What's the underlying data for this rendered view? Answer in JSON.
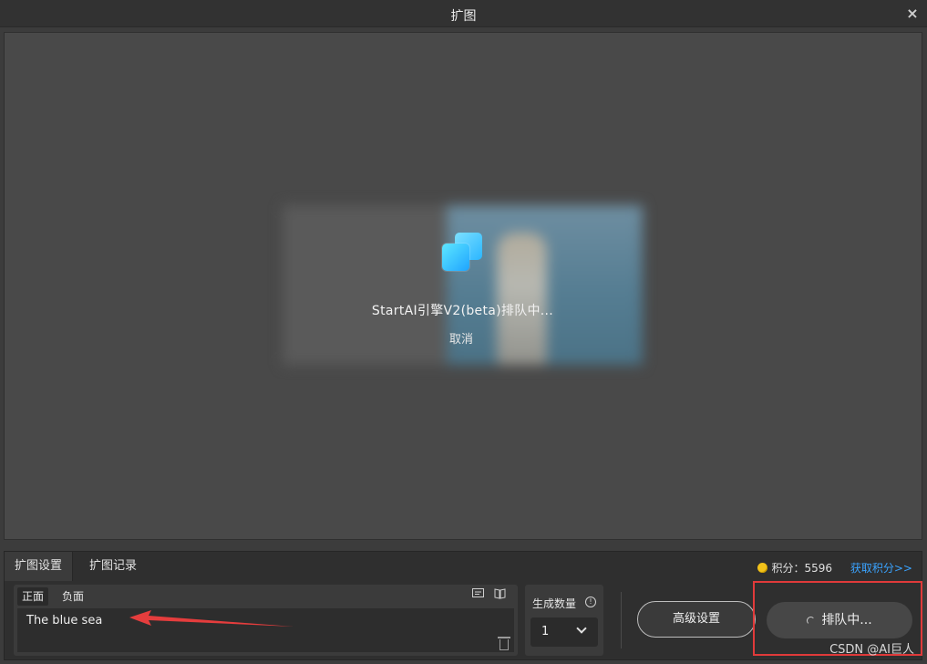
{
  "window": {
    "title": "扩图",
    "close_glyph": "×"
  },
  "canvas": {
    "status_text": "StartAI引擎V2(beta)排队中...",
    "cancel_label": "取消"
  },
  "panel": {
    "tabs": [
      {
        "label": "扩图设置",
        "active": true
      },
      {
        "label": "扩图记录",
        "active": false
      }
    ],
    "credits_label": "积分：5596",
    "get_credits_label": "获取积分>>",
    "prompt": {
      "tabs": [
        {
          "label": "正面",
          "active": true
        },
        {
          "label": "负面",
          "active": false
        }
      ],
      "value": "The blue sea"
    },
    "count": {
      "label": "生成数量",
      "value": "1"
    },
    "advanced_label": "高级设置",
    "queue_label": "排队中..."
  },
  "icons": {
    "close": "close-icon",
    "coin": "coin-icon",
    "trash": "trash-icon",
    "info": "info-icon",
    "prompt_tools": [
      "template-icon",
      "book-icon"
    ]
  },
  "colors": {
    "accent_link": "#3aa3ff",
    "highlight_box": "#e03a3a",
    "coin": "#f2c21a"
  },
  "watermark": "CSDN @AI巨人"
}
